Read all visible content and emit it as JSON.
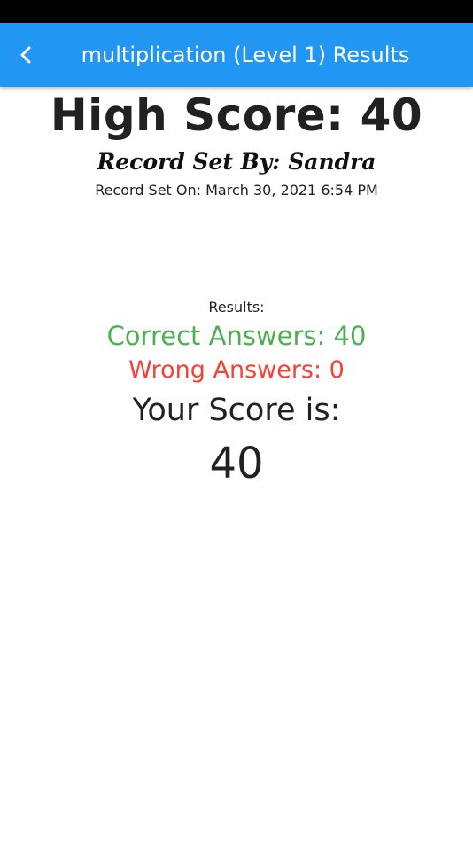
{
  "app_bar": {
    "title": "multiplication (Level 1) Results",
    "back_icon": "chevron-left-icon",
    "color": "#2196F3"
  },
  "high_score": {
    "label": "High Score: 40",
    "record_set_by": "Record Set By: Sandra",
    "record_set_on": "Record Set On: March 30, 2021 6:54 PM"
  },
  "results": {
    "label": "Results:",
    "correct_answers": "Correct Answers: 40",
    "wrong_answers": "Wrong Answers: 0",
    "your_score_label": "Your Score is:",
    "your_score_value": "40",
    "correct_color": "#4CAF50",
    "wrong_color": "#F44336"
  }
}
